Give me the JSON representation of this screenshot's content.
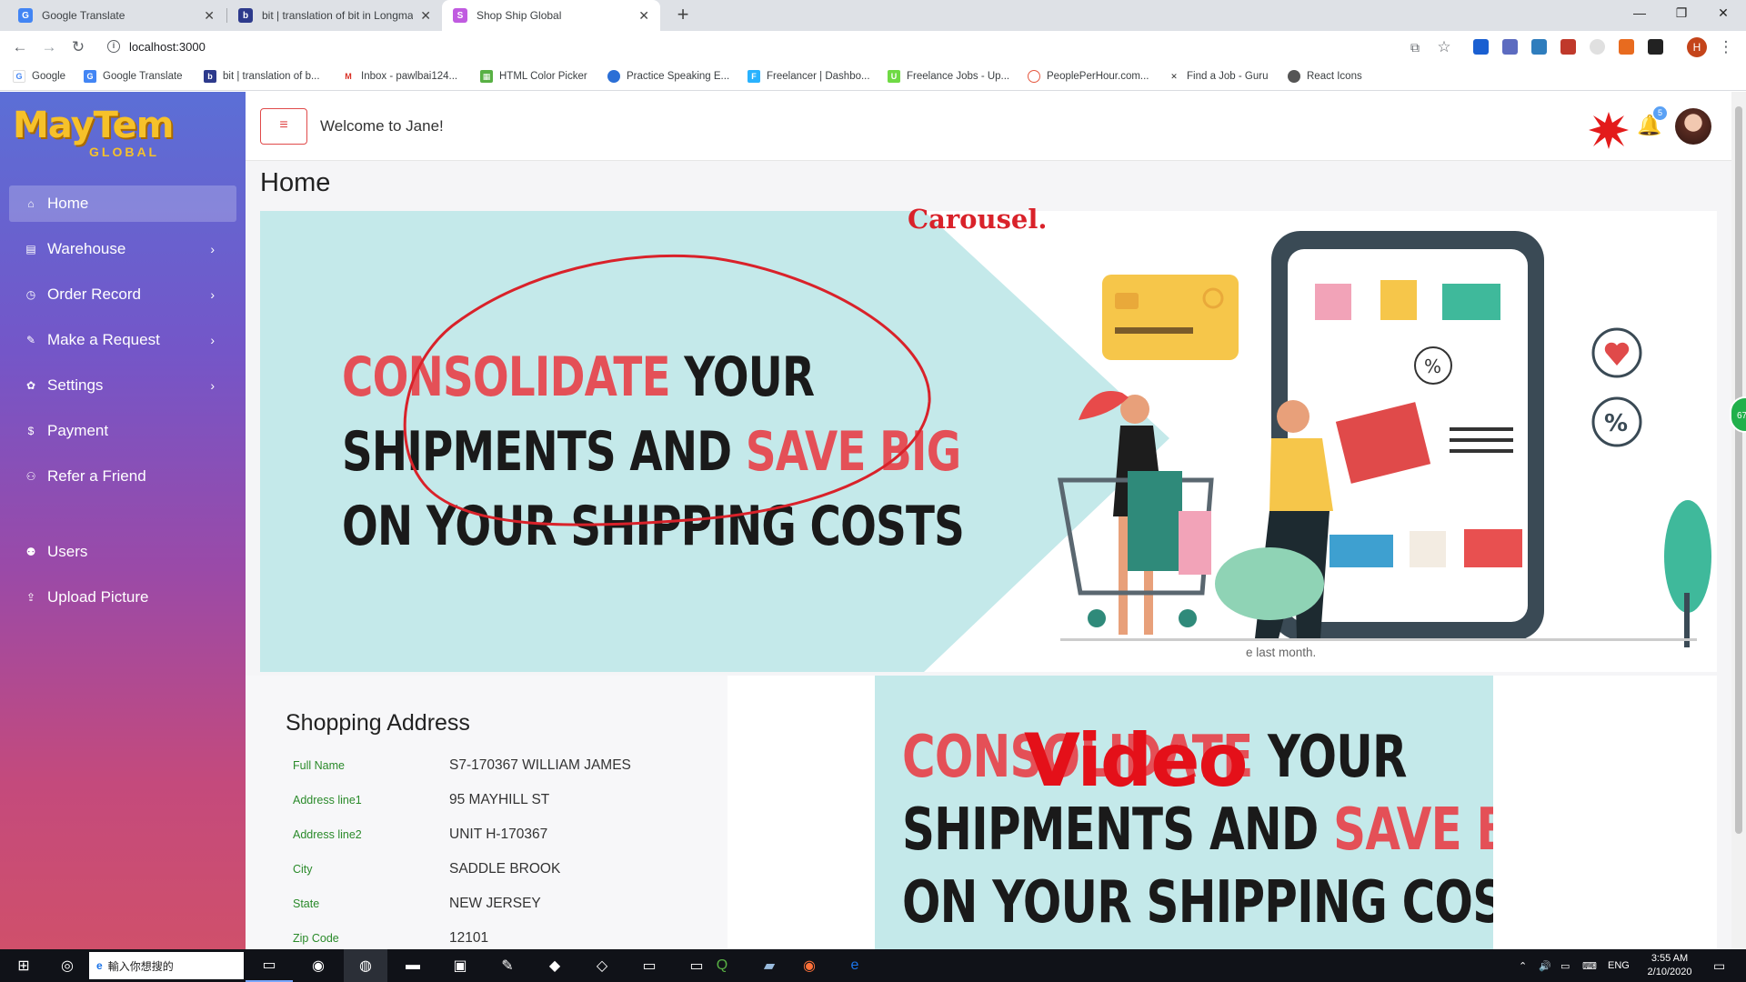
{
  "browser": {
    "tabs": [
      {
        "title": "Google Translate",
        "active": false
      },
      {
        "title": "bit | translation of bit in Longma",
        "active": false
      },
      {
        "title": "Shop Ship Global",
        "active": true
      }
    ],
    "url": "localhost:3000",
    "bookmarks": [
      {
        "label": "Google",
        "icon": "google-icon"
      },
      {
        "label": "Google Translate",
        "icon": "translate-icon"
      },
      {
        "label": "bit | translation of b...",
        "icon": "longman-icon"
      },
      {
        "label": "Inbox - pawlbai124...",
        "icon": "gmail-icon"
      },
      {
        "label": "HTML Color Picker",
        "icon": "colorpicker-icon"
      },
      {
        "label": "Practice Speaking E...",
        "icon": "practice-icon"
      },
      {
        "label": "Freelancer | Dashbo...",
        "icon": "freelancer-icon"
      },
      {
        "label": "Freelance Jobs - Up...",
        "icon": "upwork-icon"
      },
      {
        "label": "PeoplePerHour.com...",
        "icon": "pph-icon"
      },
      {
        "label": "Find a Job - Guru",
        "icon": "guru-icon"
      },
      {
        "label": "React Icons",
        "icon": "react-icon"
      }
    ],
    "profile_initial": "H"
  },
  "sidebar": {
    "logo": {
      "main": "MayTem",
      "sub": "GLOBAL"
    },
    "items": [
      {
        "label": "Home",
        "icon": "home-icon",
        "active": true,
        "chevron": false
      },
      {
        "label": "Warehouse",
        "icon": "warehouse-icon",
        "active": false,
        "chevron": true
      },
      {
        "label": "Order Record",
        "icon": "history-icon",
        "active": false,
        "chevron": true
      },
      {
        "label": "Make a Request",
        "icon": "wrench-icon",
        "active": false,
        "chevron": true
      },
      {
        "label": "Settings",
        "icon": "gear-icon",
        "active": false,
        "chevron": true
      },
      {
        "label": "Payment",
        "icon": "dollar-icon",
        "active": false,
        "chevron": false
      },
      {
        "label": "Refer a Friend",
        "icon": "add-user-icon",
        "active": false,
        "chevron": false
      },
      {
        "label": "Users",
        "icon": "users-icon",
        "active": false,
        "chevron": false
      },
      {
        "label": "Upload Picture",
        "icon": "upload-icon",
        "active": false,
        "chevron": false
      }
    ]
  },
  "header": {
    "welcome": "Welcome to Jane!",
    "notification_count": "5"
  },
  "page": {
    "title": "Home",
    "carousel_annotation": "Carousel.",
    "video_annotation": "Video",
    "side_note": "e last month.",
    "banner": {
      "line1_red": "CONSOLIDATE",
      "line1_black": " YOUR",
      "line2_black": "SHIPMENTS AND ",
      "line2_red": "SAVE BIG",
      "line3_black": "ON YOUR SHIPPING COSTS"
    }
  },
  "shopping_address": {
    "title": "Shopping Address",
    "rows": [
      {
        "label": "Full Name",
        "value": "S7-170367 WILLIAM JAMES"
      },
      {
        "label": "Address line1",
        "value": "95 MAYHILL ST"
      },
      {
        "label": "Address line2",
        "value": "UNIT H-170367"
      },
      {
        "label": "City",
        "value": "SADDLE BROOK"
      },
      {
        "label": "State",
        "value": "NEW JERSEY"
      },
      {
        "label": "Zip Code",
        "value": "12101"
      }
    ]
  },
  "taskbar": {
    "search_placeholder": "輸入你想搜的",
    "language": "ENG",
    "time": "3:55 AM",
    "date": "2/10/2020",
    "bubble": "67"
  },
  "colors": {
    "accent_red": "#e45057",
    "annotation_red": "#d9222a",
    "label_green": "#2a8a2a",
    "banner_bg": "#c4e9ea"
  }
}
